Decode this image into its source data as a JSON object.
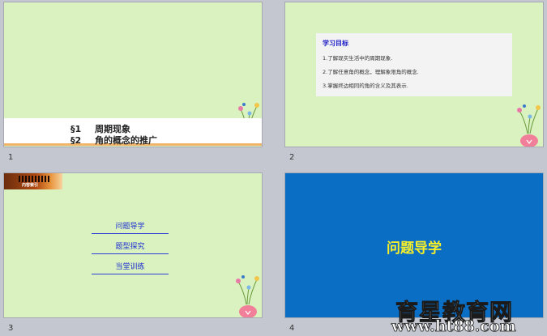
{
  "slides": [
    {
      "number": "1",
      "titles": [
        {
          "section": "§1",
          "text": "周期现象"
        },
        {
          "section": "§2",
          "text": "角的概念的推广"
        }
      ]
    },
    {
      "number": "2",
      "heading": "学习目标",
      "items": [
        "1.了解现实生活中的周期现象.",
        "2.了解任意角的概念，理解象限角的概念.",
        "3.掌握终边相同的角的含义及其表示."
      ]
    },
    {
      "number": "3",
      "banner_caption": "内容索引",
      "links": [
        "问题导学",
        "题型探究",
        "当堂训练"
      ]
    },
    {
      "number": "4",
      "title": "问题导学"
    }
  ],
  "watermark": {
    "line1": "育星教育网",
    "line2": "www.ht88.com"
  },
  "colors": {
    "slide_green": "#d9f2c0",
    "slide_blue": "#0b6ec5",
    "link_blue": "#1f2fd0",
    "title_yellow": "#f7ef2a"
  }
}
